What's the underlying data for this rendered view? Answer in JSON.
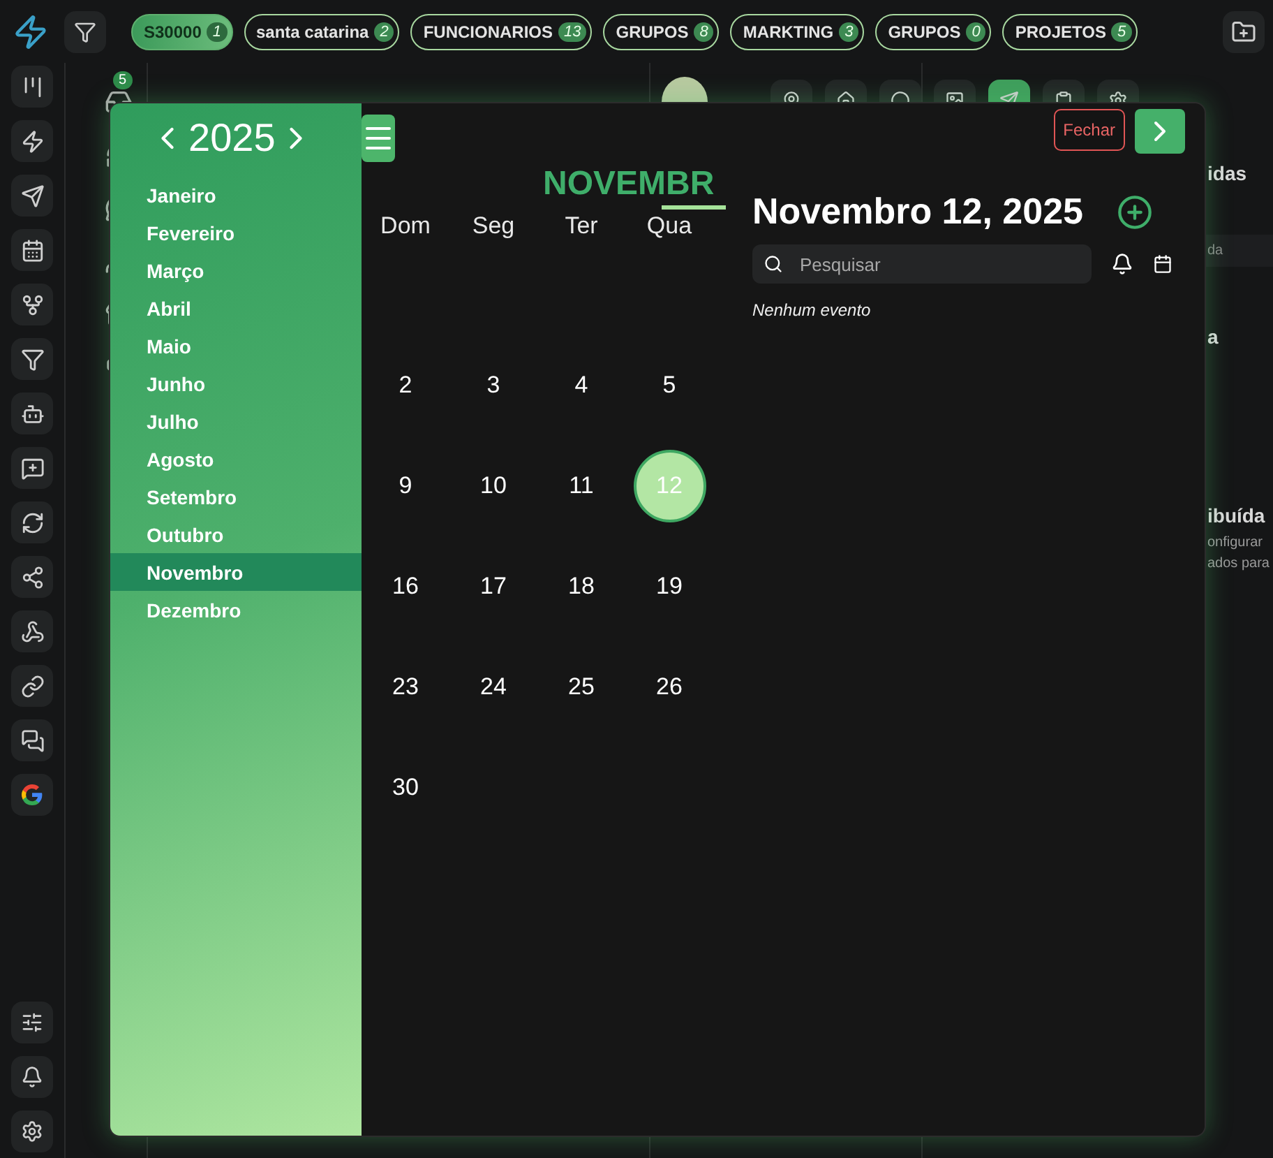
{
  "top_bar": {
    "chips": [
      {
        "label": "S30000",
        "count": "1",
        "selected": true
      },
      {
        "label": "santa catarina",
        "count": "2",
        "selected": false
      },
      {
        "label": "FUNCIONARIOS",
        "count": "13",
        "selected": false
      },
      {
        "label": "GRUPOS",
        "count": "8",
        "selected": false
      },
      {
        "label": "MARKTING",
        "count": "3",
        "selected": false
      },
      {
        "label": "GRUPOS",
        "count": "0",
        "selected": false
      },
      {
        "label": "PROJETOS",
        "count": "5",
        "selected": false
      }
    ]
  },
  "inbox_badge": "5",
  "background_fragments": [
    {
      "kind": "heading",
      "text": "idas"
    },
    {
      "kind": "field",
      "text": "da"
    },
    {
      "kind": "heading",
      "text": "a"
    },
    {
      "kind": "heading",
      "text": "ibuída"
    },
    {
      "kind": "body",
      "text": "onfigurar"
    },
    {
      "kind": "body",
      "text": "ados para"
    }
  ],
  "calendar": {
    "year": "2025",
    "close_label": "Fechar",
    "months": [
      {
        "label": "Janeiro",
        "selected": false
      },
      {
        "label": "Fevereiro",
        "selected": false
      },
      {
        "label": "Março",
        "selected": false
      },
      {
        "label": "Abril",
        "selected": false
      },
      {
        "label": "Maio",
        "selected": false
      },
      {
        "label": "Junho",
        "selected": false
      },
      {
        "label": "Julho",
        "selected": false
      },
      {
        "label": "Agosto",
        "selected": false
      },
      {
        "label": "Setembro",
        "selected": false
      },
      {
        "label": "Outubro",
        "selected": false
      },
      {
        "label": "Novembro",
        "selected": true
      },
      {
        "label": "Dezembro",
        "selected": false
      }
    ],
    "month_title": "NOVEMBR",
    "weekdays": [
      "Dom",
      "Seg",
      "Ter",
      "Qua"
    ],
    "weeks": [
      [
        {
          "label": "2",
          "selected": false
        },
        {
          "label": "3",
          "selected": false
        },
        {
          "label": "4",
          "selected": false
        },
        {
          "label": "5",
          "selected": false
        }
      ],
      [
        {
          "label": "9",
          "selected": false
        },
        {
          "label": "10",
          "selected": false
        },
        {
          "label": "11",
          "selected": false
        },
        {
          "label": "12",
          "selected": true
        }
      ],
      [
        {
          "label": "16",
          "selected": false
        },
        {
          "label": "17",
          "selected": false
        },
        {
          "label": "18",
          "selected": false
        },
        {
          "label": "19",
          "selected": false
        }
      ],
      [
        {
          "label": "23",
          "selected": false
        },
        {
          "label": "24",
          "selected": false
        },
        {
          "label": "25",
          "selected": false
        },
        {
          "label": "26",
          "selected": false
        }
      ],
      [
        {
          "label": "30",
          "selected": false
        }
      ]
    ],
    "date_heading": "Novembro 12, 2025",
    "search": {
      "placeholder": "Pesquisar"
    },
    "empty_text": "Nenhum evento"
  }
}
